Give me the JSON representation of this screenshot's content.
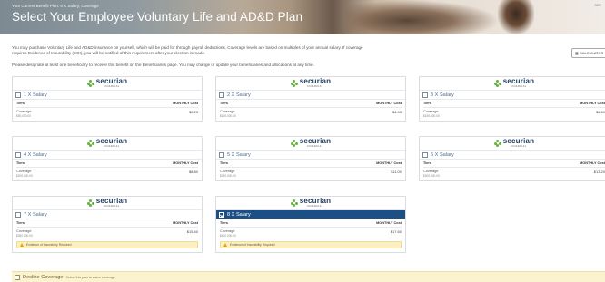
{
  "header": {
    "breadcrumb": "Your Current Benefit Plan: 6 X Salary, Coverage",
    "title": "Select Your Employee Voluntary Life and AD&D Plan",
    "corner_label": "SCS"
  },
  "intro": {
    "paragraph": "You may purchase Voluntary Life and AD&D insurance on yourself, which will be paid for through payroll deductions. Coverage levels are based on multiples of your annual salary. If coverage requires Evidence of Insurability (EOI), you will be notified of this requirement after your election is made.",
    "beneficiary_note": "Please designate at least one beneficiary to receive this benefit on the Beneficiaries page. You may change or update your beneficiaries and allocations at any time."
  },
  "calculator_button": {
    "label": "CALCULATOR"
  },
  "brand": {
    "name": "securian",
    "tagline": "FINANCIAL",
    "green": "#63b23f",
    "navy": "#1f3b5a"
  },
  "colors": {
    "selected": "#1c4f86",
    "eoi_bg": "#fbf0c5",
    "link": "#4b6f93"
  },
  "table_headers": {
    "tiers": "Tiers",
    "cost": "MONTHLY Cost"
  },
  "plans": [
    {
      "label": "1 X Salary",
      "tier": "Coverage",
      "amount": "$50,000.00",
      "cost": "$2.20",
      "selected": false,
      "eoi": false
    },
    {
      "label": "2 X Salary",
      "tier": "Coverage",
      "amount": "$100,000.00",
      "cost": "$4.40",
      "selected": false,
      "eoi": false
    },
    {
      "label": "3 X Salary",
      "tier": "Coverage",
      "amount": "$150,000.00",
      "cost": "$6.60",
      "selected": false,
      "eoi": false
    },
    {
      "label": "4 X Salary",
      "tier": "Coverage",
      "amount": "$200,000.00",
      "cost": "$8.80",
      "selected": false,
      "eoi": false
    },
    {
      "label": "5 X Salary",
      "tier": "Coverage",
      "amount": "$250,000.00",
      "cost": "$11.00",
      "selected": false,
      "eoi": false
    },
    {
      "label": "6 X Salary",
      "tier": "Coverage",
      "amount": "$300,000.00",
      "cost": "$13.20",
      "selected": false,
      "eoi": false
    },
    {
      "label": "7 X Salary",
      "tier": "Coverage",
      "amount": "$350,000.00",
      "cost": "$15.40",
      "selected": false,
      "eoi": true
    },
    {
      "label": "8 X Salary",
      "tier": "Coverage",
      "amount": "$400,000.00",
      "cost": "$17.60",
      "selected": true,
      "eoi": true
    }
  ],
  "eoi_text": "Evidence of Insurability Required",
  "decline": {
    "label": "Decline Coverage",
    "sub": "Select this plan to waive coverage"
  }
}
